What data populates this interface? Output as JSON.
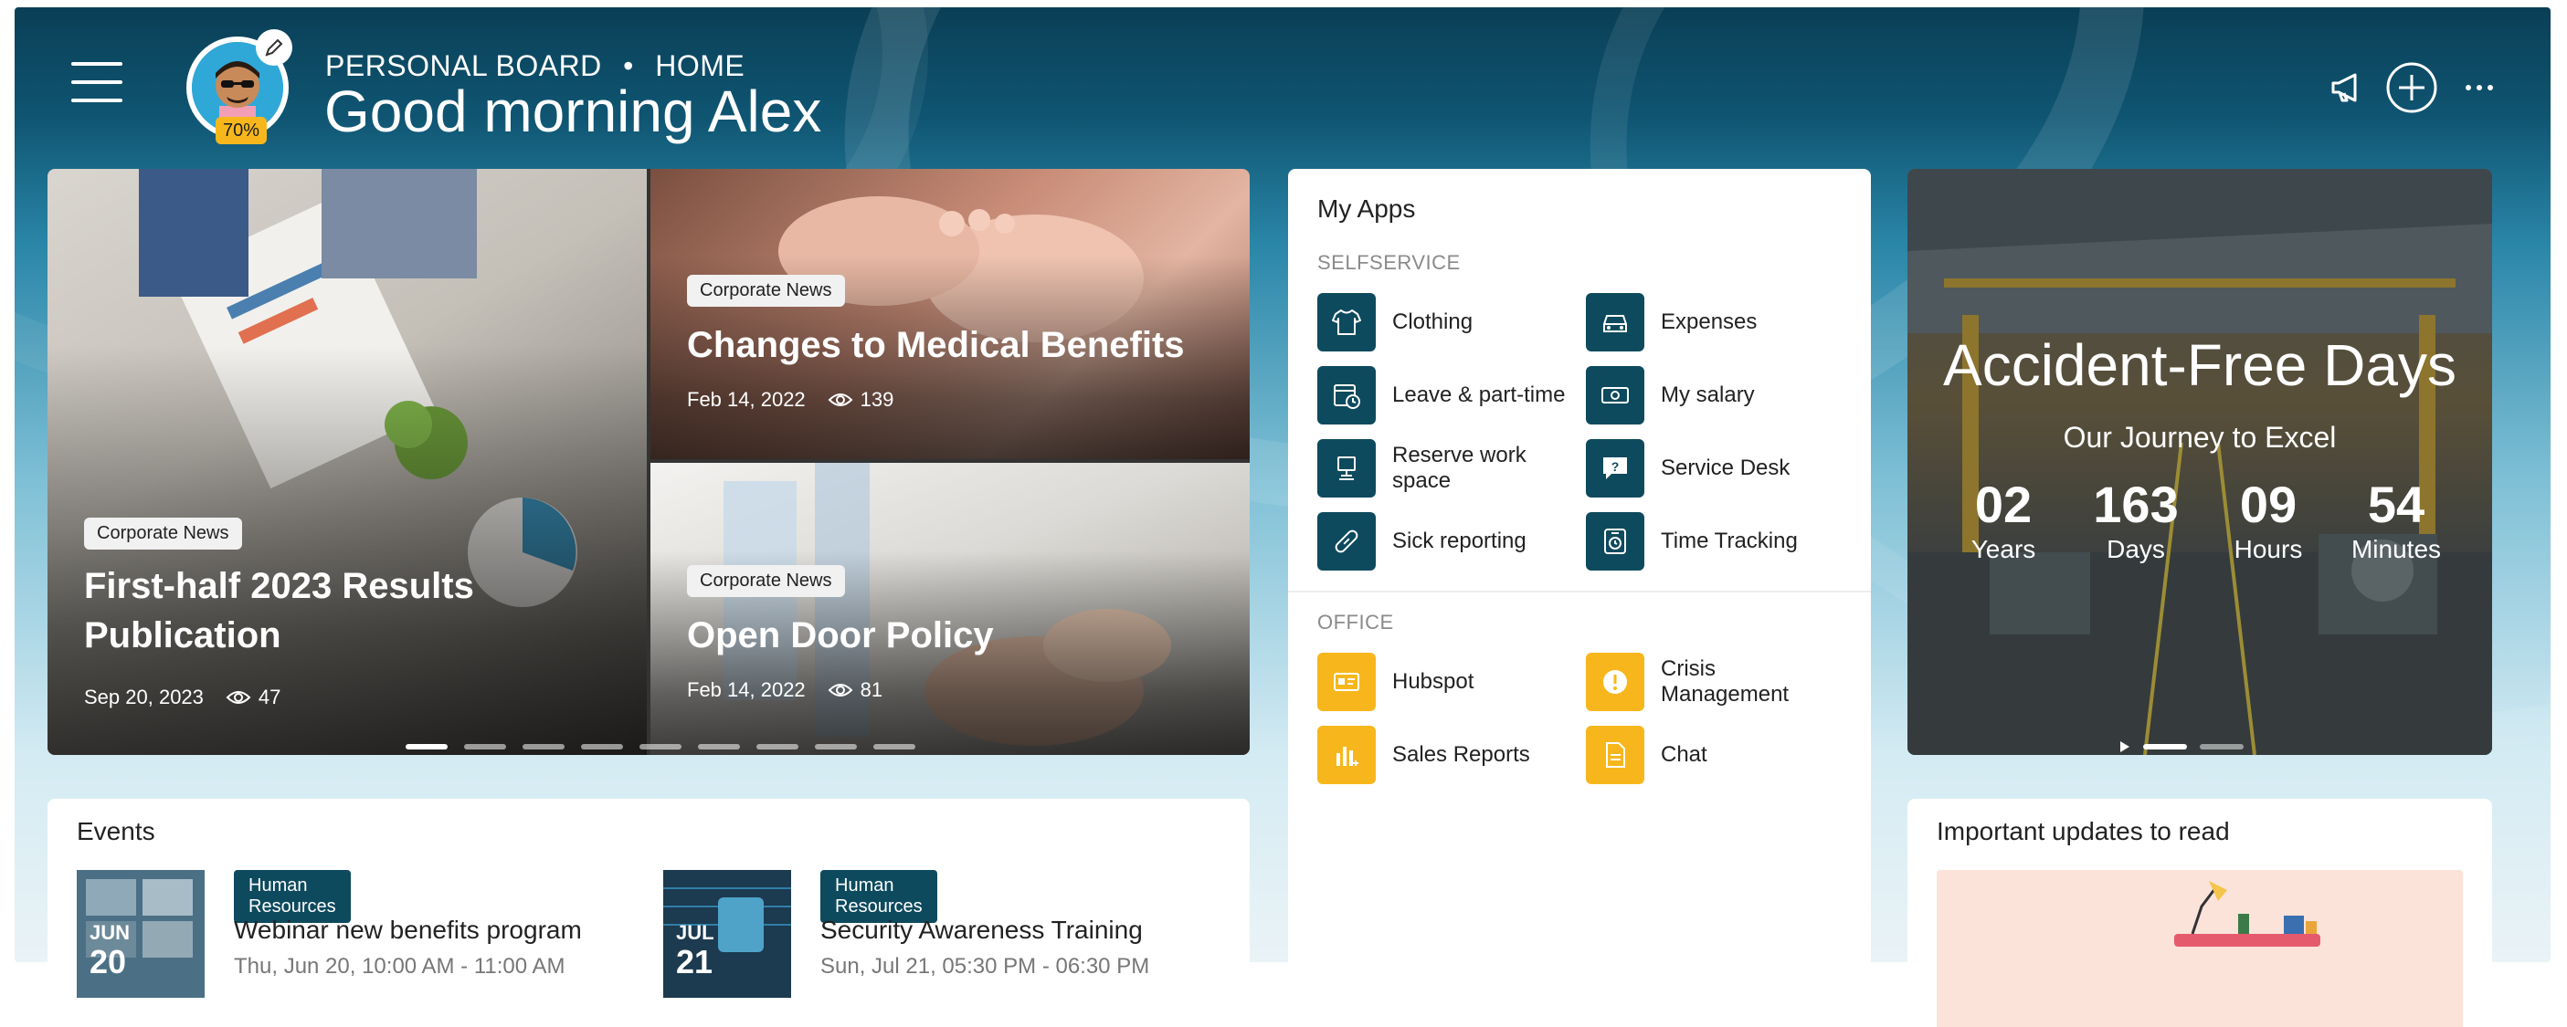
{
  "header": {
    "breadcrumb_1": "PERSONAL BOARD",
    "breadcrumb_sep": "•",
    "breadcrumb_2": "HOME",
    "greeting": "Good morning Alex",
    "profile_progress": "70%"
  },
  "news": {
    "items": [
      {
        "category": "Corporate News",
        "title_line1": "First-half 2023 Results",
        "title_line2": "Publication",
        "date": "Sep 20, 2023",
        "views": "47"
      },
      {
        "category": "Corporate News",
        "title": "Changes to Medical Benefits",
        "date": "Feb 14, 2022",
        "views": "139"
      },
      {
        "category": "Corporate News",
        "title": "Open Door Policy",
        "date": "Feb 14, 2022",
        "views": "81"
      }
    ],
    "slide_count": 9,
    "active_slide": 1
  },
  "apps": {
    "title": "My Apps",
    "selfservice_label": "SELFSERVICE",
    "selfservice": [
      {
        "label": "Clothing",
        "icon": "shirt-icon"
      },
      {
        "label": "Expenses",
        "icon": "car-icon"
      },
      {
        "label": "Leave & part-time",
        "icon": "calendar-clock-icon"
      },
      {
        "label": "My salary",
        "icon": "money-icon"
      },
      {
        "label": "Reserve work space",
        "icon": "desk-icon"
      },
      {
        "label": "Service Desk",
        "icon": "help-chat-icon"
      },
      {
        "label": "Sick reporting",
        "icon": "bandage-icon"
      },
      {
        "label": "Time Tracking",
        "icon": "stopwatch-icon"
      }
    ],
    "office_label": "OFFICE",
    "office": [
      {
        "label": "Hubspot",
        "icon": "id-card-icon"
      },
      {
        "label": "Crisis Management",
        "icon": "alert-icon"
      },
      {
        "label": "Sales Reports",
        "icon": "bar-chart-icon"
      },
      {
        "label": "Chat",
        "icon": "document-icon"
      }
    ]
  },
  "accident": {
    "title": "Accident-Free Days",
    "subtitle": "Our Journey to Excel",
    "counters": [
      {
        "value": "02",
        "unit": "Years"
      },
      {
        "value": "163",
        "unit": "Days"
      },
      {
        "value": "09",
        "unit": "Hours"
      },
      {
        "value": "54",
        "unit": "Minutes"
      }
    ]
  },
  "events": {
    "title": "Events",
    "items": [
      {
        "tag": "Human Resources",
        "title": "Webinar new benefits program",
        "time": "Thu, Jun 20, 10:00 AM - 11:00 AM",
        "month": "JUN",
        "day": "20"
      },
      {
        "tag": "Human Resources",
        "title": "Security Awareness Training",
        "time": "Sun, Jul 21, 05:30 PM - 06:30 PM",
        "month": "JUL",
        "day": "21"
      }
    ]
  },
  "updates": {
    "title": "Important updates to read"
  },
  "colors": {
    "brand_dark": "#0e4a5e",
    "accent_yellow": "#f7b71c"
  }
}
